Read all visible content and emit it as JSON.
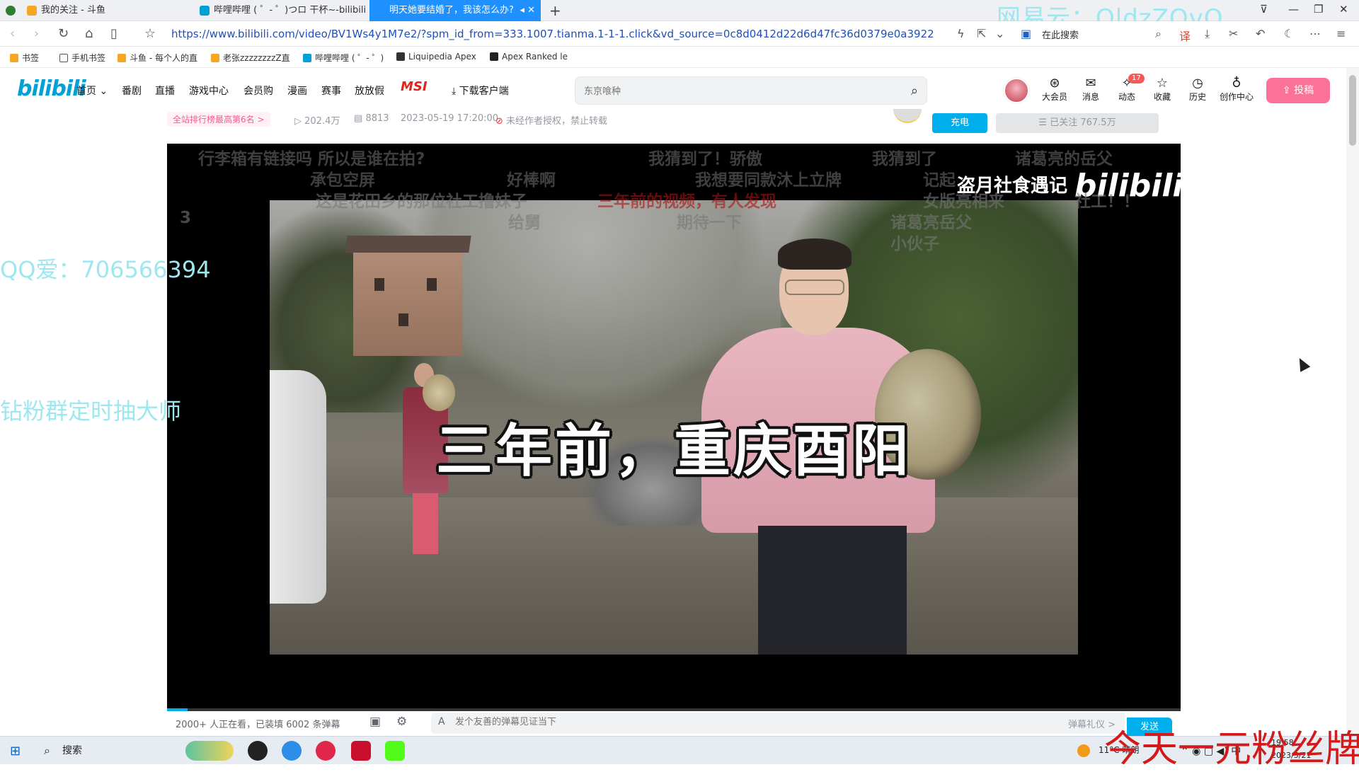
{
  "tabs": [
    {
      "label": "我的关注 - 斗鱼",
      "active": false
    },
    {
      "label": "哔哩哔哩 ( ゜- ゜)つロ 干杯~-bilibili",
      "active": false
    },
    {
      "label": "明天她要结婚了，我该怎么办?",
      "active": true
    }
  ],
  "watermark_top": "网易云：OldzZOvO",
  "address": {
    "url": "https://www.bilibili.com/video/BV1Ws4y1M7e2/?spm_id_from=333.1007.tianma.1-1-1.click&vd_source=0c8d0412d22d6d47fc36d0379e0a3922",
    "search_label": "在此搜索"
  },
  "bookmarks": [
    "书签",
    "手机书签",
    "斗鱼 - 每个人的直",
    "老张zzzzzzzzZ直",
    "哔哩哔哩 ( ゜- ゜)",
    "Liquipedia Apex",
    "Apex Ranked le"
  ],
  "header": {
    "logo": "bilibili",
    "nav": [
      "首页",
      "番剧",
      "直播",
      "游戏中心",
      "会员购",
      "漫画",
      "赛事",
      "放放假"
    ],
    "msi": "MSI",
    "download": "下载客户端",
    "search_placeholder": "东京喰种",
    "icons": [
      {
        "label": "大会员",
        "icon": "vip-icon"
      },
      {
        "label": "消息",
        "icon": "message-icon"
      },
      {
        "label": "动态",
        "icon": "dynamic-icon",
        "badge": "17"
      },
      {
        "label": "收藏",
        "icon": "star-icon"
      },
      {
        "label": "历史",
        "icon": "clock-icon"
      },
      {
        "label": "创作中心",
        "icon": "bulb-icon"
      }
    ],
    "upload": "投稿"
  },
  "meta": {
    "rank": "全站排行榜最高第6名 >",
    "views": "202.4万",
    "danmaku_count": "8813",
    "date": "2023-05-19 17:20:00",
    "copyright": "未经作者授权，禁止转载",
    "charge": "充电",
    "follow": "已关注 767.5万"
  },
  "video": {
    "subtitle": "三年前，重庆酉阳",
    "watermark": "盗月社食遇记",
    "watermark_logo": "bilibili",
    "progress": 0.02,
    "danmaku": [
      "行李箱有链接吗 所以是谁在拍?",
      "我猜到了！骄傲",
      "我猜到了",
      "诸葛亮的岳父",
      "承包空屏",
      "好棒啊",
      "我想要同款沐上立牌",
      "记起",
      "这是花田乡的那位社工撸妹子",
      "三年前的视频，有人发现",
      "女版亮相来",
      "社工！！",
      "3",
      "给舅",
      "期待一下",
      "诸葛亮岳父",
      "小伙子"
    ]
  },
  "danmaku_bar": {
    "watching": "2000+ 人正在看，已装填 6002 条弹幕",
    "placeholder": "发个友善的弹幕见证当下",
    "etiquette": "弹幕礼仪 >",
    "send": "发送"
  },
  "overlays": {
    "qq": "QQ爱：706566394",
    "fans": "钻粉群定时抽大师",
    "bottom": "今天一元粉丝牌"
  },
  "taskbar": {
    "search": "搜索",
    "weather": "11°C 晴朗",
    "time": "19:58",
    "date": "2023/5/21"
  }
}
